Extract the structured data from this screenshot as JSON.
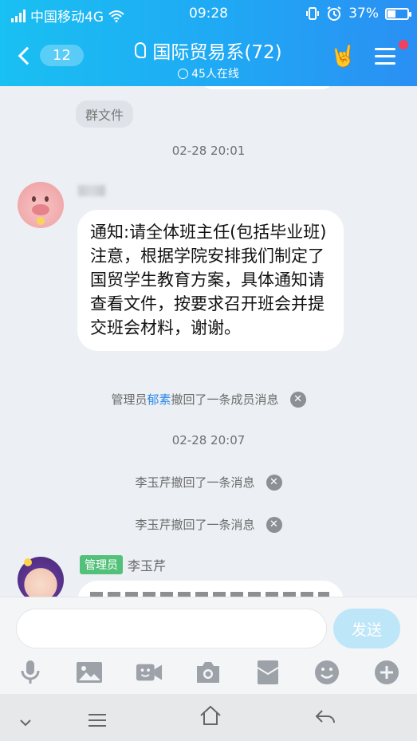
{
  "status_bar": {
    "carrier": "中国移动4G",
    "time": "09:28",
    "battery": "37%",
    "battery_level": 0.37
  },
  "header": {
    "back_count": "12",
    "title": "国际贸易系(72)",
    "online": "45人在线"
  },
  "chat": {
    "group_file_label": "群文件",
    "time_1": "02-28 20:01",
    "message_1": "通知:请全体班主任(包括毕业班)注意，根据学院安排我们制定了国贸学生教育方案，具体通知请查看文件，按要求召开班会并提交班会材料，谢谢。",
    "recall_1": {
      "prefix": "管理员",
      "name": "郁素",
      "suffix": "撤回了一条成员消息"
    },
    "time_2": "02-28 20:07",
    "recall_2": "李玉芹撤回了一条消息",
    "recall_3": "李玉芹撤回了一条消息",
    "sender_badge": "管理员",
    "sender_name": "李玉芹"
  },
  "input": {
    "value": "",
    "send_label": "发送"
  },
  "icons": [
    "mic-icon",
    "image-icon",
    "video-icon",
    "camera-icon",
    "red-packet-icon",
    "emoji-icon",
    "plus-icon"
  ],
  "colors": {
    "header": "#20a8f4",
    "accent": "#2b8ae6",
    "badge": "#53c17a",
    "send": "#bde6f8"
  }
}
